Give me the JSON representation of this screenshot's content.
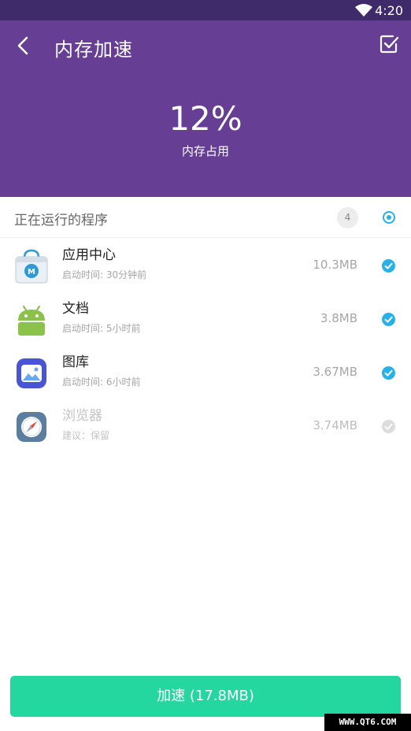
{
  "status_bar": {
    "time": "4:20"
  },
  "header": {
    "title": "内存加速",
    "percent": "12%",
    "percent_label": "内存占用"
  },
  "section": {
    "title": "正在运行的程序",
    "count": "4"
  },
  "apps": [
    {
      "name": "应用中心",
      "sub": "启动时间: 30分钟前",
      "size": "10.3MB",
      "checked": true
    },
    {
      "name": "文档",
      "sub": "启动时间: 5小时前",
      "size": "3.8MB",
      "checked": true
    },
    {
      "name": "图库",
      "sub": "启动时间: 6小时前",
      "size": "3.67MB",
      "checked": true
    },
    {
      "name": "浏览器",
      "sub": "建议：保留",
      "size": "3.74MB",
      "checked": false
    }
  ],
  "accelerate_button": "加速 (17.8MB)",
  "watermark": "WWW.QT6.COM",
  "colors": {
    "header": "#663f94",
    "status_bar": "#3f2a6a",
    "accent": "#28b0e8",
    "button": "#24d79f"
  },
  "icons": {
    "back": "chevron-left-icon",
    "edit": "checklist-icon",
    "wifi": "wifi-icon",
    "app_center": "shopping-bag-icon",
    "docs": "android-icon",
    "gallery": "gallery-icon",
    "browser": "compass-icon"
  }
}
